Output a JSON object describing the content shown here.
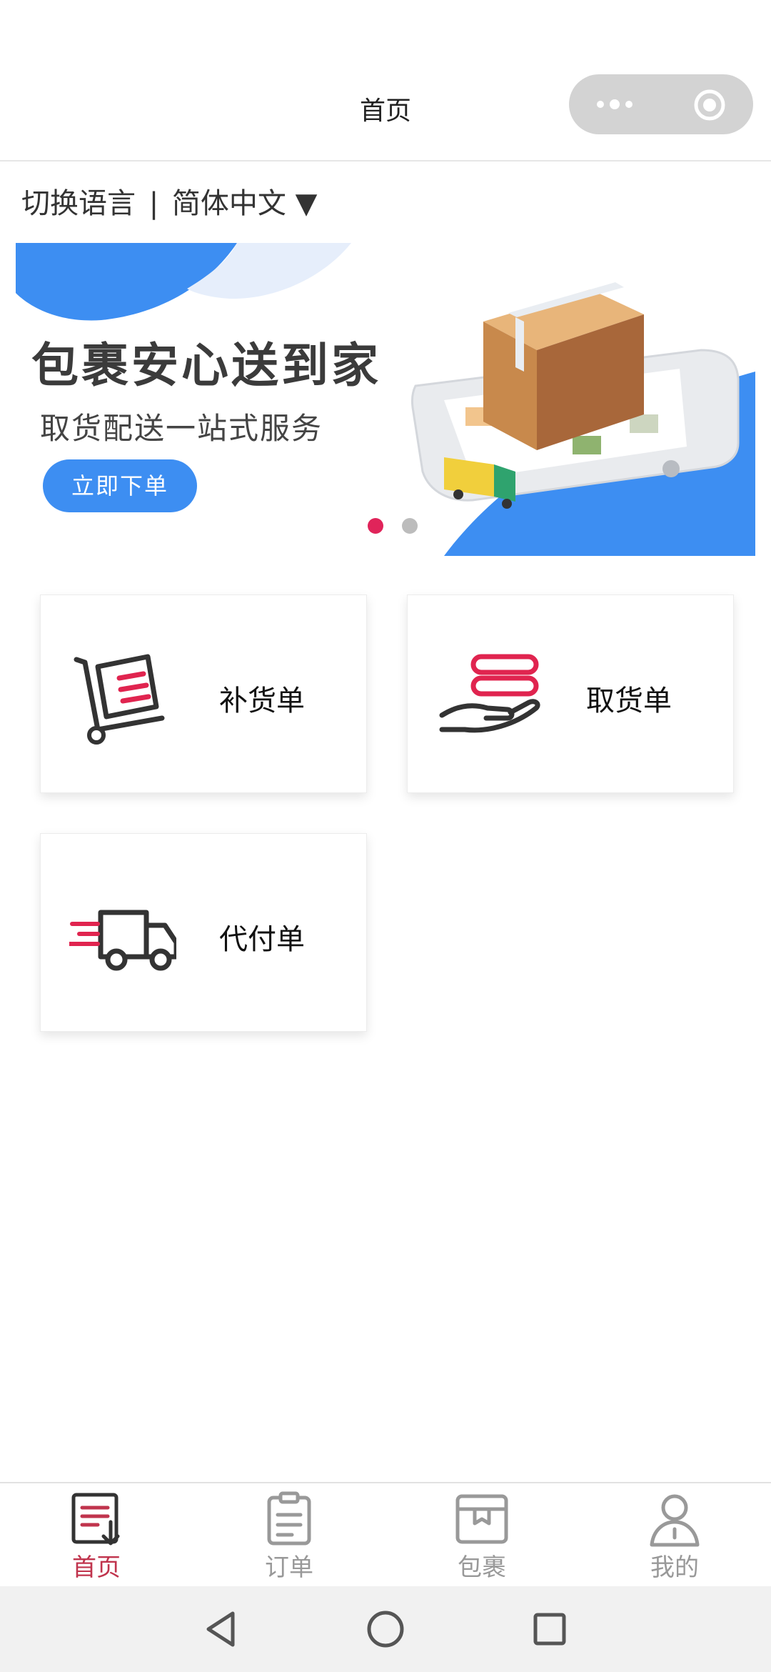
{
  "header": {
    "title": "首页",
    "capsule": {
      "more_icon": "more-dots-icon",
      "close_icon": "target-circle-icon"
    }
  },
  "language": {
    "label": "切换语言",
    "separator": "|",
    "current": "简体中文",
    "arrow": "▼"
  },
  "banner": {
    "title": "包裹安心送到家",
    "subtitle": "取货配送一站式服务",
    "button_label": "立即下单",
    "slide_count": 2,
    "active_slide": 1,
    "colors": {
      "accent_blue": "#3d8ef2",
      "dot_active": "#e0245a",
      "dot_idle": "#bcbcbc"
    }
  },
  "cards": [
    {
      "label": "补货单",
      "icon": "hand-truck-icon"
    },
    {
      "label": "取货单",
      "icon": "hand-receive-icon"
    },
    {
      "label": "代付单",
      "icon": "delivery-truck-icon"
    }
  ],
  "tabbar": {
    "items": [
      {
        "label": "首页",
        "icon": "home-doc-icon",
        "active": true
      },
      {
        "label": "订单",
        "icon": "clipboard-icon",
        "active": false
      },
      {
        "label": "包裹",
        "icon": "package-box-icon",
        "active": false
      },
      {
        "label": "我的",
        "icon": "user-icon",
        "active": false
      }
    ],
    "colors": {
      "active": "#c0344d",
      "inactive": "#999999"
    }
  },
  "system_nav": {
    "back_icon": "back-triangle-icon",
    "home_icon": "home-circle-icon",
    "recent_icon": "recent-square-icon"
  }
}
